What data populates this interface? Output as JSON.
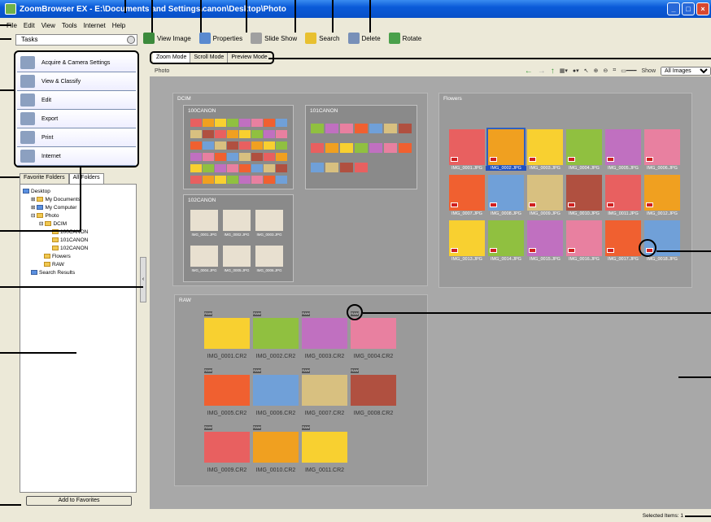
{
  "window": {
    "title": "ZoomBrowser EX - E:\\Documents and Settings\\canon\\Desktop\\Photo"
  },
  "menu": [
    "File",
    "Edit",
    "View",
    "Tools",
    "Internet",
    "Help"
  ],
  "toolbar": {
    "view_image": "View Image",
    "properties": "Properties",
    "slide_show": "Slide Show",
    "search": "Search",
    "delete": "Delete",
    "rotate": "Rotate"
  },
  "tasks": {
    "header": "Tasks",
    "items": [
      "Acquire & Camera Settings",
      "View & Classify",
      "Edit",
      "Export",
      "Print",
      "Internet"
    ]
  },
  "folders": {
    "tabs": [
      "Favorite Folders",
      "All Folders"
    ],
    "tree": [
      "Desktop",
      "My Documents",
      "My Computer",
      "Photo",
      "DCIM",
      "100CANON",
      "101CANON",
      "102CANON",
      "Flowers",
      "RAW",
      "Search Results"
    ],
    "add_favorites": "Add to Favorites"
  },
  "modes": [
    "Zoom Mode",
    "Scroll Mode",
    "Preview Mode"
  ],
  "view": {
    "header": "Photo",
    "show_label": "Show",
    "show_value": "All Images"
  },
  "groups": {
    "dcim": "DCIM",
    "c100": "100CANON",
    "c101": "101CANON",
    "c102": "102CANON",
    "flowers": "Flowers",
    "raw": "RAW"
  },
  "flowers_files": [
    "IMG_0001.JPG",
    "IMG_0002.JPG",
    "IMG_0003.JPG",
    "IMG_0004.JPG",
    "IMG_0005.JPG",
    "IMG_0006.JPG",
    "IMG_0007.JPG",
    "IMG_0008.JPG",
    "IMG_0009.JPG",
    "IMG_0010.JPG",
    "IMG_0011.JPG",
    "IMG_0012.JPG",
    "IMG_0013.JPG",
    "IMG_0014.JPG",
    "IMG_0015.JPG",
    "IMG_0016.JPG",
    "IMG_0017.JPG",
    "IMG_0018.JPG"
  ],
  "c102_files": [
    "IMG_0001.JPG",
    "IMG_0002.JPG",
    "IMG_0003.JPG",
    "IMG_0004.JPG",
    "IMG_0005.JPG",
    "IMG_0006.JPG"
  ],
  "raw_files": [
    "IMG_0001.CR2",
    "IMG_0002.CR2",
    "IMG_0003.CR2",
    "IMG_0004.CR2",
    "IMG_0005.CR2",
    "IMG_0006.CR2",
    "IMG_0007.CR2",
    "IMG_0008.CR2",
    "IMG_0009.CR2",
    "IMG_0010.CR2",
    "IMG_0011.CR2"
  ],
  "raw_badge": "RAW",
  "status": {
    "selected": "Selected Items: 1"
  }
}
